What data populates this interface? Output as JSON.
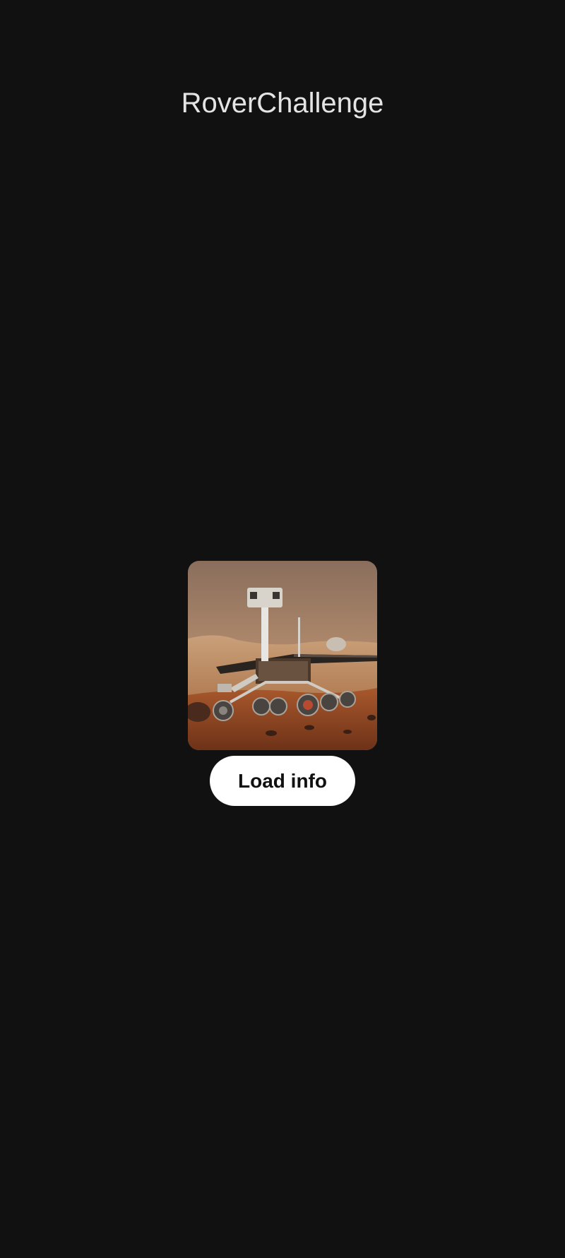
{
  "app": {
    "title": "RoverChallenge"
  },
  "main": {
    "image_subject": "mars-rover",
    "button_label": "Load info"
  },
  "colors": {
    "background": "#111112",
    "title_text": "#e4e4e4",
    "button_bg": "#ffffff",
    "button_text": "#111112"
  }
}
